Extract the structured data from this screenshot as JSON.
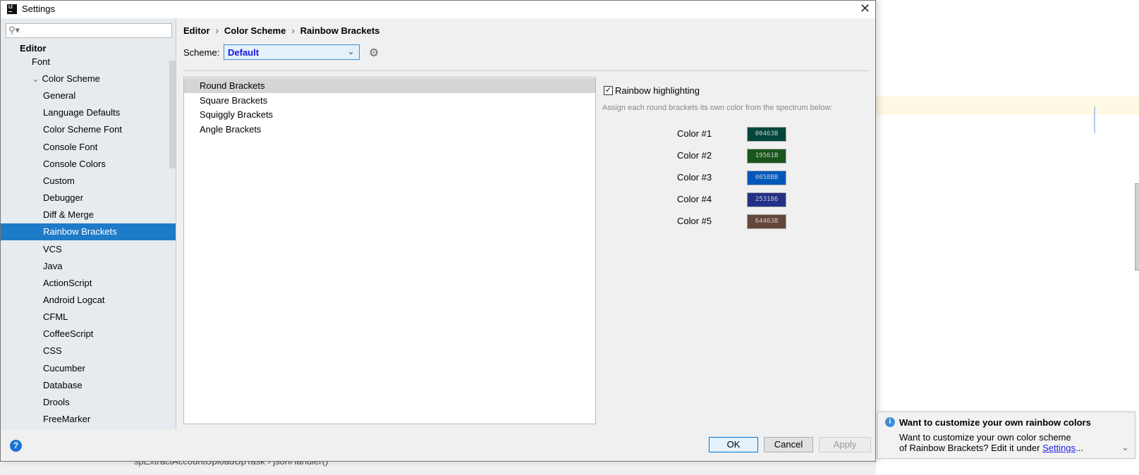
{
  "window": {
    "title": "Settings",
    "logo": "IJ"
  },
  "sidebar": {
    "search_placeholder": "",
    "items": [
      {
        "label": "Editor"
      },
      {
        "label": "Font"
      },
      {
        "label": "Color Scheme"
      },
      {
        "label": "General"
      },
      {
        "label": "Language Defaults"
      },
      {
        "label": "Color Scheme Font"
      },
      {
        "label": "Console Font"
      },
      {
        "label": "Console Colors"
      },
      {
        "label": "Custom"
      },
      {
        "label": "Debugger"
      },
      {
        "label": "Diff & Merge"
      },
      {
        "label": "Rainbow Brackets"
      },
      {
        "label": "VCS"
      },
      {
        "label": "Java"
      },
      {
        "label": "ActionScript"
      },
      {
        "label": "Android Logcat"
      },
      {
        "label": "CFML"
      },
      {
        "label": "CoffeeScript"
      },
      {
        "label": "CSS"
      },
      {
        "label": "Cucumber"
      },
      {
        "label": "Database"
      },
      {
        "label": "Drools"
      },
      {
        "label": "FreeMarker"
      }
    ],
    "selected": "Rainbow Brackets"
  },
  "breadcrumb": [
    "Editor",
    "Color Scheme",
    "Rainbow Brackets"
  ],
  "scheme": {
    "label": "Scheme:",
    "value": "Default"
  },
  "bracket_types": [
    "Round Brackets",
    "Square Brackets",
    "Squiggly Brackets",
    "Angle Brackets"
  ],
  "options": {
    "rainbow_label": "Rainbow highlighting",
    "rainbow_checked": true,
    "hint": "Assign each round brackets its own color from the spectrum below:",
    "colors": [
      {
        "label": "Color #1",
        "hex": "00463B"
      },
      {
        "label": "Color #2",
        "hex": "19561B"
      },
      {
        "label": "Color #3",
        "hex": "0058BB"
      },
      {
        "label": "Color #4",
        "hex": "253186"
      },
      {
        "label": "Color #5",
        "hex": "64463B"
      }
    ]
  },
  "buttons": {
    "ok": "OK",
    "cancel": "Cancel",
    "apply": "Apply"
  },
  "notification": {
    "title": "Want to customize your own rainbow colors",
    "line1": "Want to customize your own color scheme",
    "line2": "of Rainbow Brackets? Edit it under ",
    "link": "Settings",
    "ellipsis": "..."
  },
  "background_editor": {
    "breadcrumb": "spExtractAccountUploadUpTask  ›  jsonHandler()"
  }
}
